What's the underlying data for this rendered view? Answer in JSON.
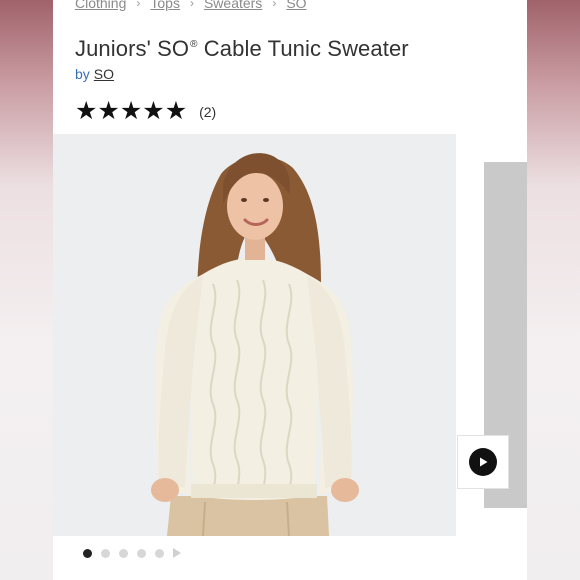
{
  "breadcrumb": [
    "Clothing",
    "Tops",
    "Sweaters",
    "SO"
  ],
  "product": {
    "title": "Juniors' SO",
    "title_mark": "®",
    "title_rest": " Cable Tunic Sweater",
    "by_label": "by",
    "brand": "SO",
    "rating": 5,
    "review_count": "(2)"
  },
  "gallery": {
    "dot_count": 5,
    "active_dot": 0,
    "video_icon": "play-icon"
  },
  "colors": {
    "brand_link": "#3a6fb5",
    "sweater": "#f3efe2"
  }
}
